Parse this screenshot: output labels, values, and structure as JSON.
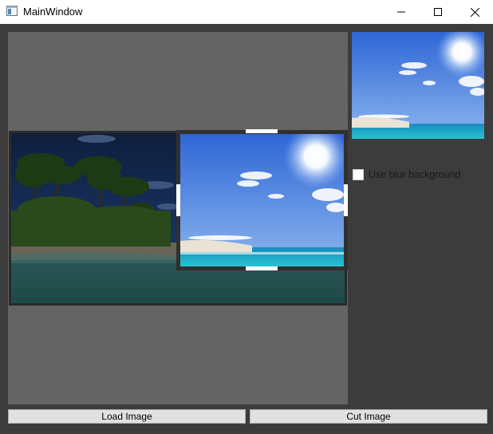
{
  "window": {
    "title": "MainWindow",
    "controls": {
      "minimize_icon": "minimize-icon",
      "maximize_icon": "maximize-icon",
      "close_icon": "close-icon"
    }
  },
  "options": {
    "use_blur_background_label": "Use blur background",
    "use_blur_background_checked": false
  },
  "buttons": {
    "load_image_label": "Load Image",
    "cut_image_label": "Cut Image"
  },
  "colors": {
    "window_background": "#3c3c3c",
    "canvas_background": "#646464",
    "button_background": "#e1e1e1",
    "titlebar_background": "#ffffff"
  }
}
